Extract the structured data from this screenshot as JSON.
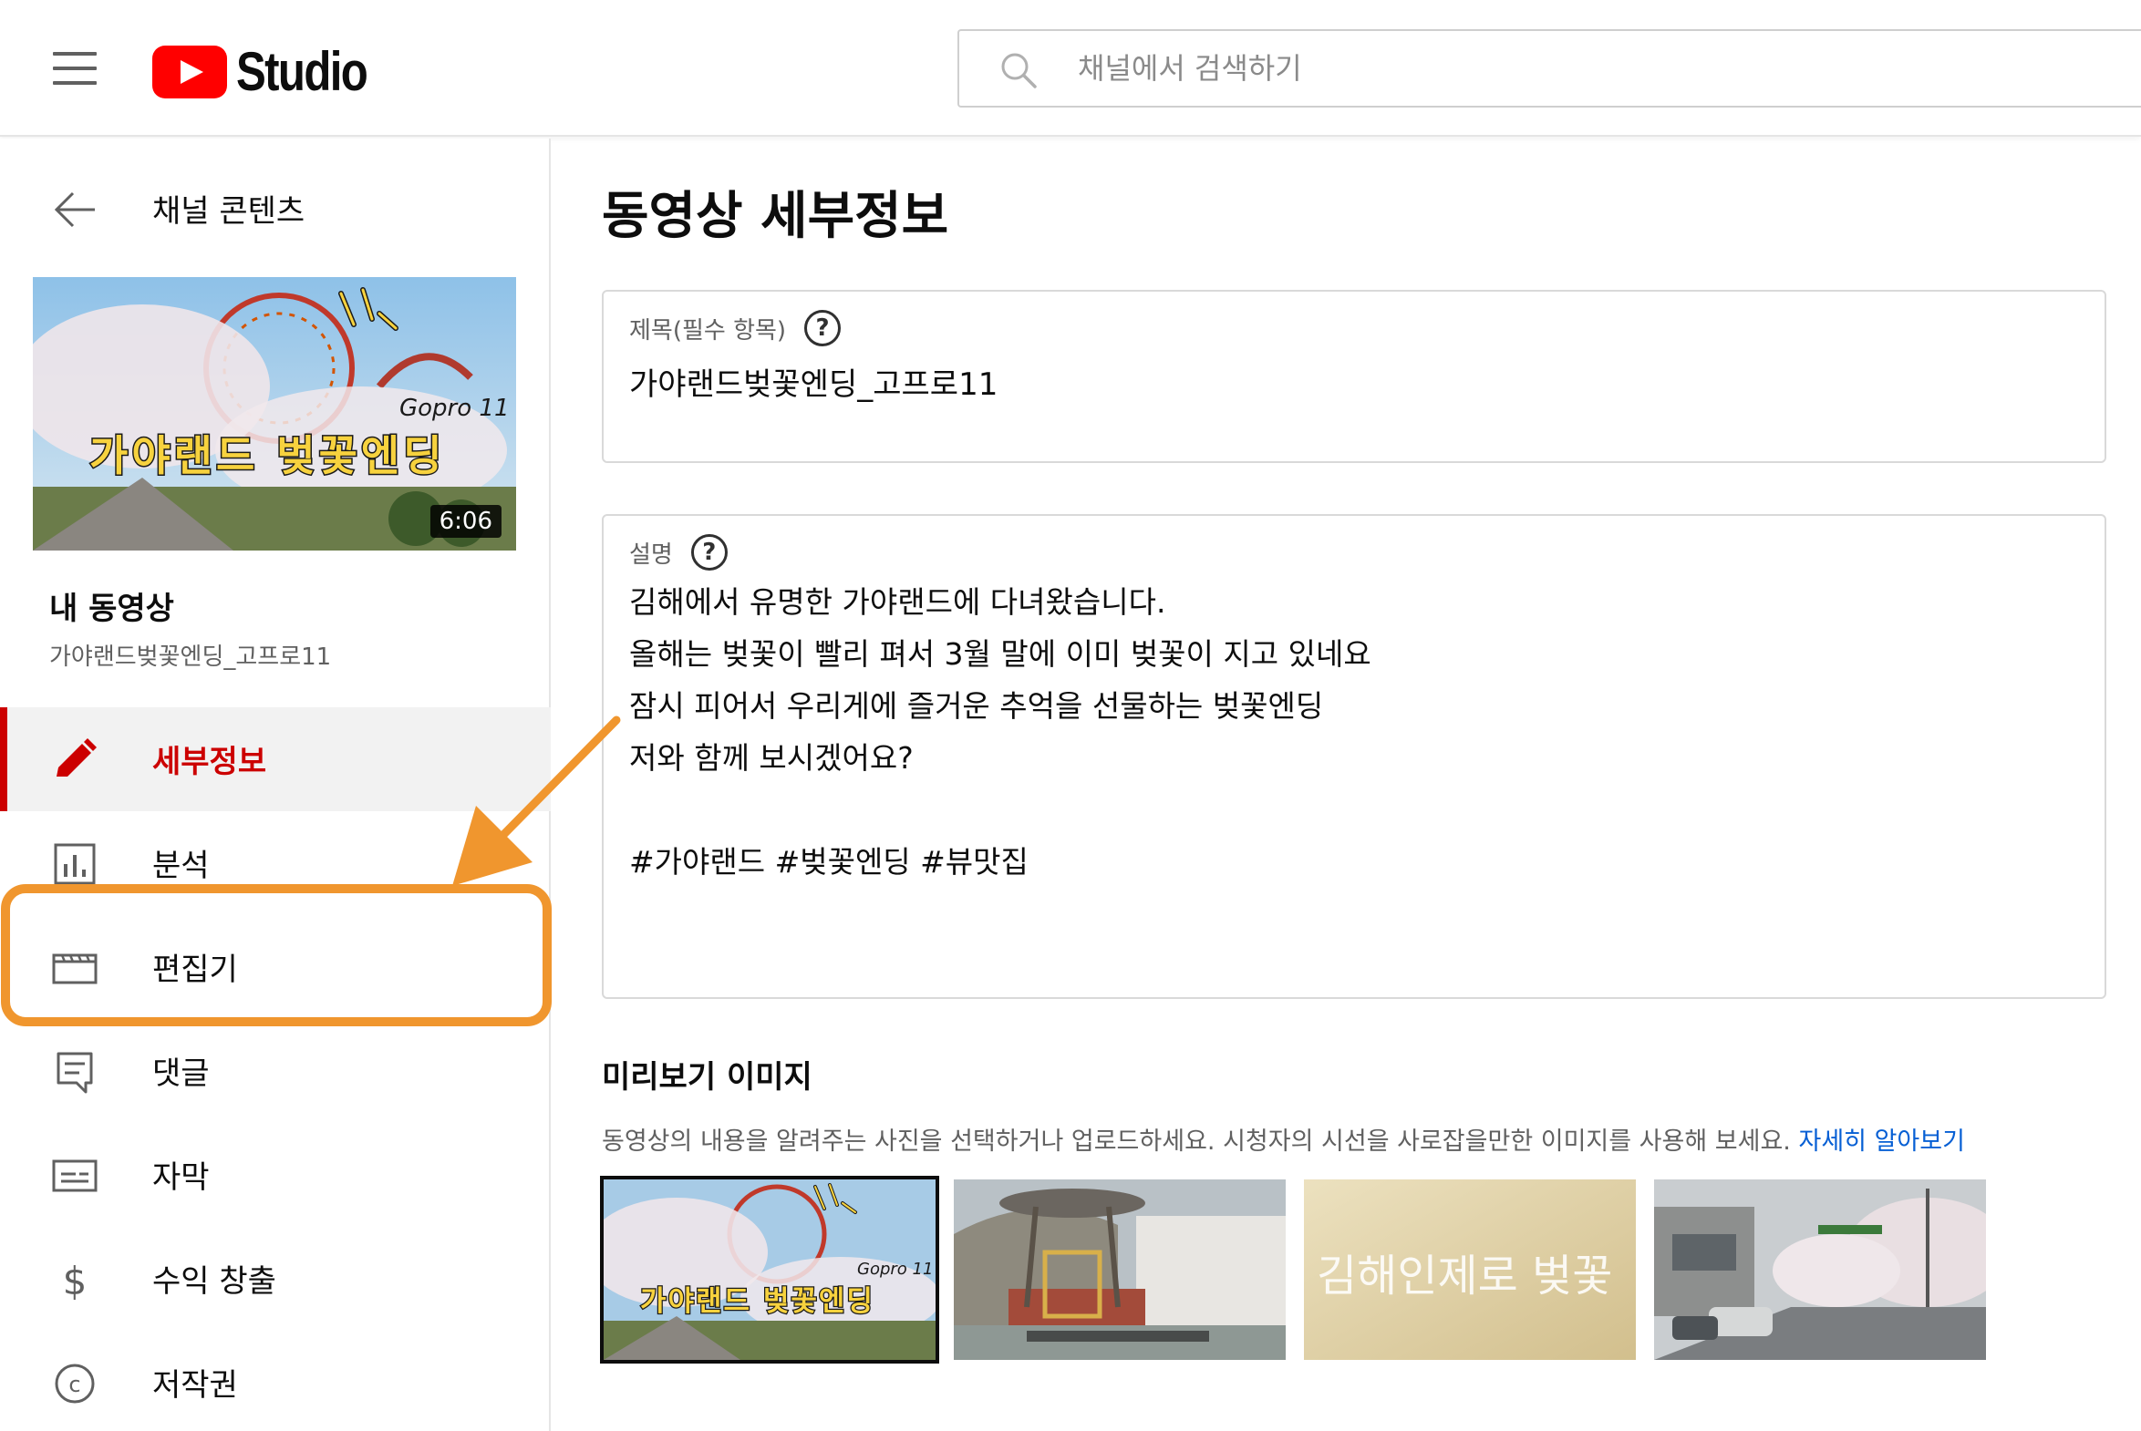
{
  "header": {
    "logo_text": "Studio",
    "search_placeholder": "채널에서 검색하기"
  },
  "sidebar": {
    "back_label": "채널 콘텐츠",
    "video": {
      "thumb_caption_small": "Gopro 11",
      "thumb_caption_big": "가야랜드 벚꽃엔딩",
      "duration": "6:06",
      "section_title": "내 동영상",
      "name": "가야랜드벚꽃엔딩_고프로11"
    },
    "nav": [
      {
        "label": "세부정보",
        "icon": "pencil-icon",
        "active": true
      },
      {
        "label": "분석",
        "icon": "analytics-icon",
        "active": false
      },
      {
        "label": "편집기",
        "icon": "clapperboard-icon",
        "active": false
      },
      {
        "label": "댓글",
        "icon": "comment-icon",
        "active": false
      },
      {
        "label": "자막",
        "icon": "subtitles-icon",
        "active": false
      },
      {
        "label": "수익 창출",
        "icon": "dollar-icon",
        "active": false
      },
      {
        "label": "저작권",
        "icon": "copyright-icon",
        "active": false
      }
    ]
  },
  "main": {
    "page_title": "동영상 세부정보",
    "title_field": {
      "label": "제목(필수 항목)",
      "help": "?",
      "value": "가야랜드벚꽃엔딩_고프로11"
    },
    "description_field": {
      "label": "설명",
      "help": "?",
      "lines": [
        "김해에서 유명한 가야랜드에 다녀왔습니다.",
        "올해는 벚꽃이 빨리 펴서 3월 말에 이미 벚꽃이 지고 있네요",
        "잠시 피어서 우리게에 즐거운 추억을 선물하는 벚꽃엔딩",
        "저와 함께 보시겠어요?",
        "",
        "#가야랜드 #벚꽃엔딩 #뷰맛집"
      ]
    },
    "preview": {
      "heading": "미리보기 이미지",
      "description": "동영상의 내용을 알려주는 사진을 선택하거나 업로드하세요. 시청자의 시선을 사로잡을만한 이미지를 사용해 보세요.",
      "learn_more": "자세히 알아보기",
      "thumb3_text": "김해인제로 벚꽃"
    }
  },
  "colors": {
    "brand_red": "#ff0000",
    "active_red": "#cc0000",
    "link_blue": "#065fd4",
    "annotation_orange": "#f0962e"
  }
}
